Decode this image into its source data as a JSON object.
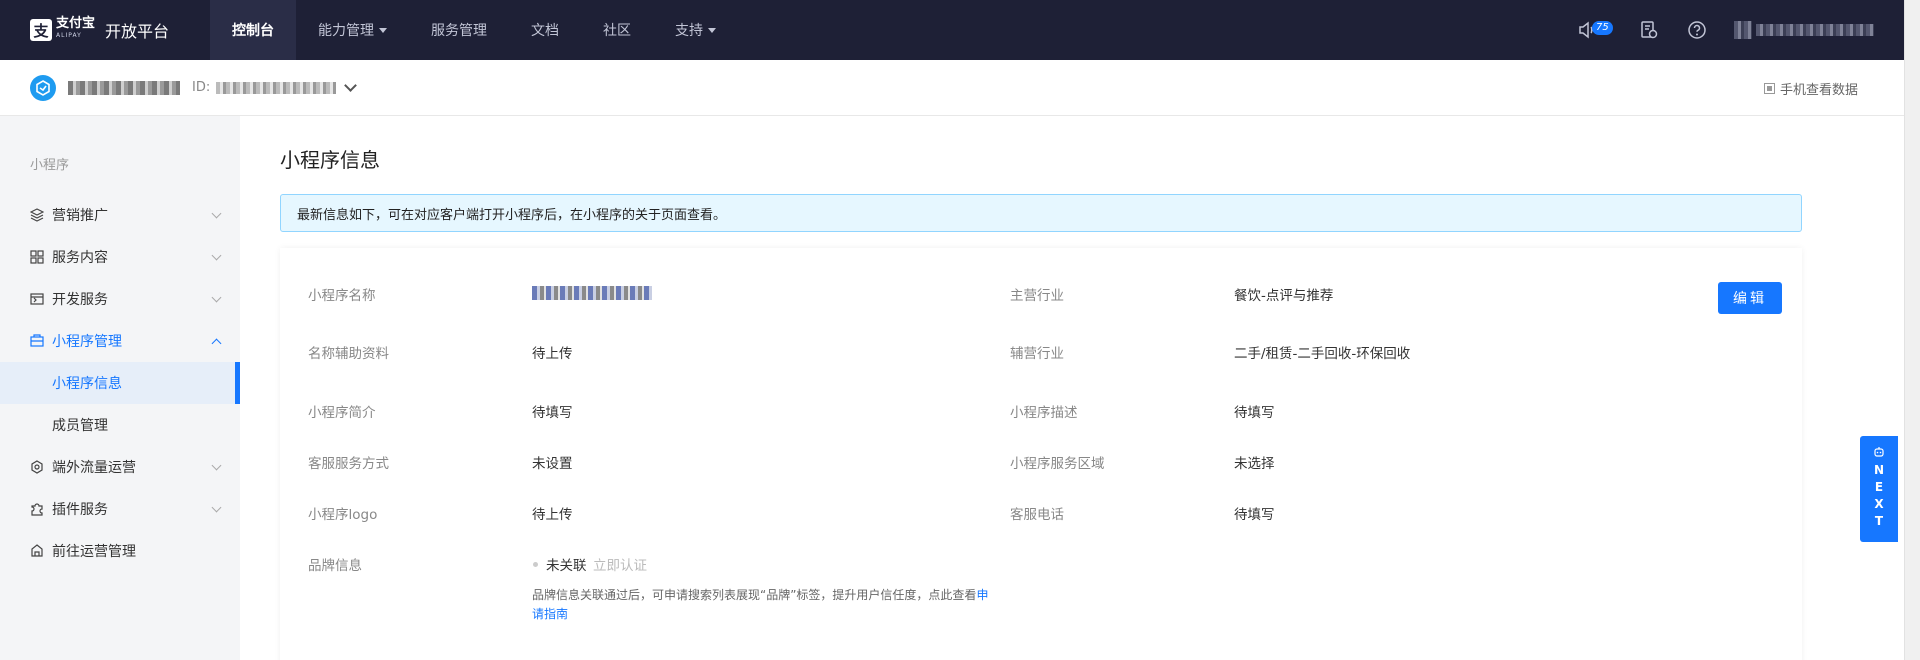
{
  "topnav": {
    "brand_name": "支付宝",
    "brand_sub": "ALIPAY",
    "platform": "开放平台",
    "items": [
      {
        "label": "控制台",
        "active": true,
        "caret": false
      },
      {
        "label": "能力管理",
        "active": false,
        "caret": true
      },
      {
        "label": "服务管理",
        "active": false,
        "caret": false
      },
      {
        "label": "文档",
        "active": false,
        "caret": false
      },
      {
        "label": "社区",
        "active": false,
        "caret": false
      },
      {
        "label": "支持",
        "active": false,
        "caret": true
      }
    ],
    "notification_count": "75"
  },
  "subheader": {
    "id_label": "ID:",
    "phone_data": "手机查看数据"
  },
  "sidebar": {
    "group": "小程序",
    "items": [
      {
        "label": "营销推广",
        "icon": "layers-icon"
      },
      {
        "label": "服务内容",
        "icon": "grid-icon"
      },
      {
        "label": "开发服务",
        "icon": "code-icon"
      },
      {
        "label": "小程序管理",
        "icon": "app-manage-icon",
        "open": true
      },
      {
        "label": "端外流量运营",
        "icon": "traffic-icon"
      },
      {
        "label": "插件服务",
        "icon": "plugin-icon"
      },
      {
        "label": "前往运营管理",
        "icon": "operation-icon"
      }
    ],
    "subitems": [
      {
        "label": "小程序信息",
        "active": true
      },
      {
        "label": "成员管理",
        "active": false
      }
    ]
  },
  "main": {
    "title": "小程序信息",
    "notice": "最新信息如下，可在对应客户端打开小程序后，在小程序的关于页面查看。",
    "edit_label": "编辑",
    "left_fields": [
      {
        "label": "小程序名称",
        "value": ""
      },
      {
        "label": "名称辅助资料",
        "value": "待上传"
      },
      {
        "label": "小程序简介",
        "value": "待填写"
      },
      {
        "label": "客服服务方式",
        "value": "未设置"
      },
      {
        "label": "小程序logo",
        "value": "待上传"
      },
      {
        "label": "品牌信息",
        "value": "未关联"
      }
    ],
    "right_fields": [
      {
        "label": "主营行业",
        "value": "餐饮-点评与推荐"
      },
      {
        "label": "辅营行业",
        "value": "二手/租赁-二手回收-环保回收"
      },
      {
        "label": "小程序描述",
        "value": "待填写"
      },
      {
        "label": "小程序服务区域",
        "value": "未选择"
      },
      {
        "label": "客服电话",
        "value": "待填写"
      }
    ],
    "brand_link": "立即认证",
    "brand_helper": "品牌信息关联通过后，可申请搜索列表展现“品牌”标签，提升用户信任度，点此查看",
    "brand_helper_link": "申请指南"
  },
  "next_tab": [
    "N",
    "E",
    "X",
    "T"
  ],
  "colors": {
    "nav_bg": "#1e2036",
    "accent": "#1677ff",
    "notice_bg": "#e6f7ff"
  }
}
